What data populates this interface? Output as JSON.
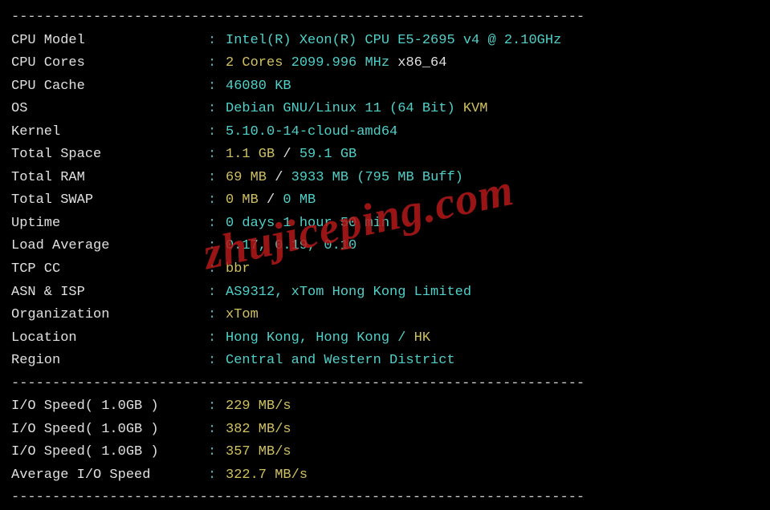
{
  "divider": "----------------------------------------------------------------------",
  "watermark": "zhujiceping.com",
  "rows": [
    {
      "label": "CPU Model",
      "parts": [
        {
          "text": "Intel(R) Xeon(R) CPU E5-2695 v4 @ 2.10GHz",
          "cls": "val-cyan"
        }
      ]
    },
    {
      "label": "CPU Cores",
      "parts": [
        {
          "text": "2 Cores ",
          "cls": "val-yellow"
        },
        {
          "text": "2099.996 MHz ",
          "cls": "val-cyan"
        },
        {
          "text": "x86_64",
          "cls": "val-white"
        }
      ]
    },
    {
      "label": "CPU Cache",
      "parts": [
        {
          "text": "46080 KB",
          "cls": "val-cyan"
        }
      ]
    },
    {
      "label": "OS",
      "parts": [
        {
          "text": "Debian GNU/Linux 11 (64 Bit) ",
          "cls": "val-cyan"
        },
        {
          "text": "KVM",
          "cls": "val-yellow"
        }
      ]
    },
    {
      "label": "Kernel",
      "parts": [
        {
          "text": "5.10.0-14-cloud-amd64",
          "cls": "val-cyan"
        }
      ]
    },
    {
      "label": "Total Space",
      "parts": [
        {
          "text": "1.1 GB ",
          "cls": "val-yellow"
        },
        {
          "text": "/ ",
          "cls": "val-white"
        },
        {
          "text": "59.1 GB",
          "cls": "val-cyan"
        }
      ]
    },
    {
      "label": "Total RAM",
      "parts": [
        {
          "text": "69 MB ",
          "cls": "val-yellow"
        },
        {
          "text": "/ ",
          "cls": "val-white"
        },
        {
          "text": "3933 MB ",
          "cls": "val-cyan"
        },
        {
          "text": "(795 MB Buff)",
          "cls": "val-cyan"
        }
      ]
    },
    {
      "label": "Total SWAP",
      "parts": [
        {
          "text": "0 MB ",
          "cls": "val-yellow"
        },
        {
          "text": "/ ",
          "cls": "val-white"
        },
        {
          "text": "0 MB",
          "cls": "val-cyan"
        }
      ]
    },
    {
      "label": "Uptime",
      "parts": [
        {
          "text": "0 days 1 hour 50 min",
          "cls": "val-cyan"
        }
      ]
    },
    {
      "label": "Load Average",
      "parts": [
        {
          "text": "0.17, 0.19, 0.10",
          "cls": "val-cyan"
        }
      ]
    },
    {
      "label": "TCP CC",
      "parts": [
        {
          "text": "bbr",
          "cls": "val-yellow"
        }
      ]
    },
    {
      "label": "ASN & ISP",
      "parts": [
        {
          "text": "AS9312, xTom Hong Kong Limited",
          "cls": "val-cyan"
        }
      ]
    },
    {
      "label": "Organization",
      "parts": [
        {
          "text": "xTom",
          "cls": "val-yellow"
        }
      ]
    },
    {
      "label": "Location",
      "parts": [
        {
          "text": "Hong Kong, Hong Kong / ",
          "cls": "val-cyan"
        },
        {
          "text": "HK",
          "cls": "val-yellow"
        }
      ]
    },
    {
      "label": "Region",
      "parts": [
        {
          "text": "Central and Western District",
          "cls": "val-cyan"
        }
      ]
    }
  ],
  "io_rows": [
    {
      "label": "I/O Speed( 1.0GB )",
      "value": "229 MB/s"
    },
    {
      "label": "I/O Speed( 1.0GB )",
      "value": "382 MB/s"
    },
    {
      "label": "I/O Speed( 1.0GB )",
      "value": "357 MB/s"
    },
    {
      "label": "Average I/O Speed",
      "value": "322.7 MB/s"
    }
  ]
}
